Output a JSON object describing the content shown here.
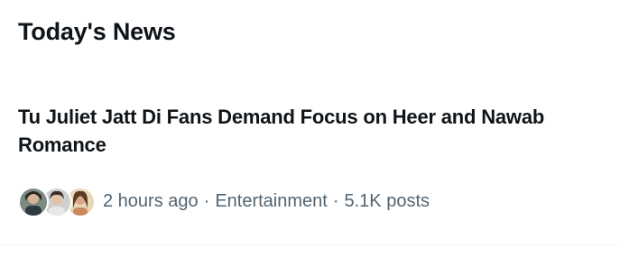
{
  "section": {
    "title": "Today's News"
  },
  "news_item": {
    "headline": "Tu Juliet Jatt Di Fans Demand Focus on Heer and Nawab Romance",
    "time": "2 hours ago",
    "separator": "·",
    "category": "Entertainment",
    "posts": "5.1K posts",
    "avatars": [
      "avatar-1",
      "avatar-2",
      "avatar-3"
    ]
  },
  "colors": {
    "text_primary": "#0f1419",
    "text_secondary": "#536471",
    "divider": "#eff3f4"
  }
}
